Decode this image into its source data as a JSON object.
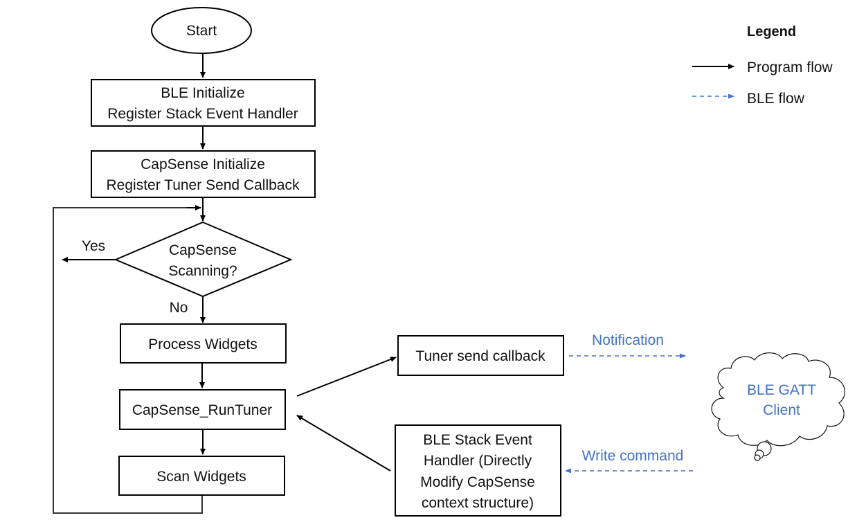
{
  "nodes": {
    "start": {
      "label": "Start"
    },
    "ble_init": {
      "line1": "BLE Initialize",
      "line2": "Register Stack Event Handler"
    },
    "capsense_init": {
      "line1": "CapSense Initialize",
      "line2": "Register Tuner Send Callback"
    },
    "decision": {
      "line1": "CapSense",
      "line2": "Scanning?"
    },
    "process_widgets": {
      "label": "Process Widgets"
    },
    "run_tuner": {
      "label": "CapSense_RunTuner"
    },
    "scan_widgets": {
      "label": "Scan Widgets"
    },
    "tuner_send": {
      "label": "Tuner send callback"
    },
    "ble_handler": {
      "line1": "BLE Stack Event",
      "line2": "Handler (Directly",
      "line3": "Modify CapSense",
      "line4": "context structure)"
    },
    "gatt_client": {
      "line1": "BLE GATT",
      "line2": "Client"
    }
  },
  "edges": {
    "yes_label": "Yes",
    "no_label": "No",
    "notification_label": "Notification",
    "write_command_label": "Write command"
  },
  "legend": {
    "title": "Legend",
    "items": [
      {
        "label": "Program flow",
        "style": "solid",
        "color": "#000000"
      },
      {
        "label": "BLE flow",
        "style": "dashed",
        "color": "#4472c4"
      }
    ]
  },
  "colors": {
    "ble_accent": "#4472c4",
    "program_flow": "#000000"
  }
}
